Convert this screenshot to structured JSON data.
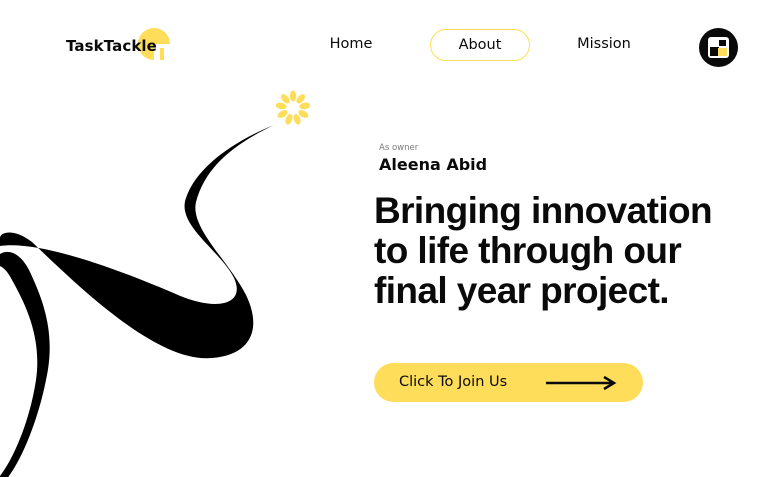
{
  "brand": {
    "name": "TaskTackle",
    "accent_color": "#fedd5a",
    "text_color": "#0a0a0a"
  },
  "nav": {
    "items": [
      {
        "label": "Home",
        "active": false
      },
      {
        "label": "About",
        "active": true
      },
      {
        "label": "Mission",
        "active": false
      }
    ],
    "profile_icon": "profile-logo-icon"
  },
  "hero": {
    "owner_caption": "As owner",
    "owner_name": "Aleena Abid",
    "headline": "Bringing innovation to life through our final year project.",
    "cta_label": "Click To Join Us",
    "cta_icon": "arrow-right-icon"
  },
  "decor": {
    "ribbon_icon": "black-ribbon-swirl",
    "spark_icon": "sun-burst-icon"
  }
}
